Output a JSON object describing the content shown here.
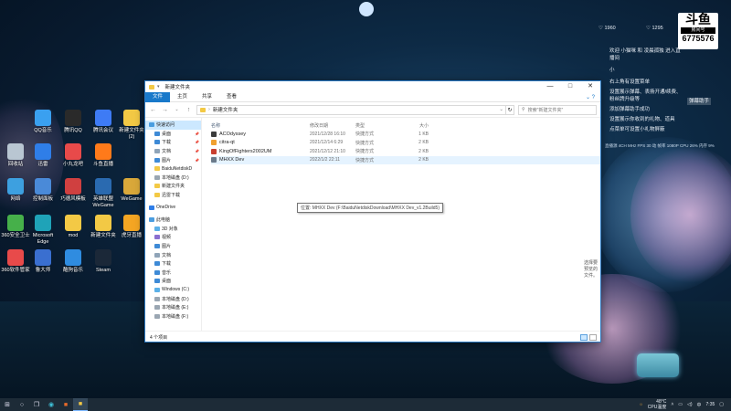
{
  "desktop": {
    "icons": [
      {
        "label": "QQ音乐",
        "color": "#3aa0f0"
      },
      {
        "label": "腾讯QQ",
        "color": "#2a2a2a"
      },
      {
        "label": "腾讯会议",
        "color": "#3e7bf5"
      },
      {
        "label": "新建文件夹 (2)",
        "color": "#f3c945"
      },
      {
        "label": "回收站",
        "color": "#b9c6d2"
      },
      {
        "label": "迅雷",
        "color": "#2f7ee8"
      },
      {
        "label": "小丸龙吧",
        "color": "#e84a4a"
      },
      {
        "label": "斗鱼直播",
        "color": "#ff7a1a"
      },
      {
        "label": "网络",
        "color": "#3da0e0"
      },
      {
        "label": "控制面板",
        "color": "#4a8ad8"
      },
      {
        "label": "巧德风模板",
        "color": "#d04040"
      },
      {
        "label": "英雄联盟WeGame",
        "color": "#2a6ab0"
      },
      {
        "label": "WeGame",
        "color": "#d9a83a"
      },
      {
        "label": "360安全卫士",
        "color": "#46b04a"
      },
      {
        "label": "Microsoft Edge",
        "color": "#1fa3b8"
      },
      {
        "label": "mod",
        "color": "#f3c945"
      },
      {
        "label": "新建文件夹",
        "color": "#f3c945"
      },
      {
        "label": "虎牙直播",
        "color": "#f5a623"
      },
      {
        "label": "360软件管家",
        "color": "#e84a4a"
      },
      {
        "label": "鲁大师",
        "color": "#3a6fd0"
      },
      {
        "label": "酷狗音乐",
        "color": "#2f8ce0"
      },
      {
        "label": "Steam",
        "color": "#1b2838"
      }
    ]
  },
  "overlay": {
    "fan_left": "1960",
    "fan_right": "1295",
    "logo_top": "斗鱼",
    "logo_sub": "房间号",
    "room_number": "6775576",
    "messages": [
      "欢迎 小猫咪 和 凌晨孤独 进入直播间",
      "小",
      "右上角有设置菜单",
      "设置展示弹幕、表扬开通/续费、粉丝牌升级等",
      "添加弹幕助手成功",
      "设置展示你收到的礼物、道具",
      "点菜单可设置小礼物屏蔽"
    ],
    "side_tag": "弹幕助手",
    "stats": "直播源  4CH  MHz  FPS 30  动 帧率  1080P  CPU 26%  内存 9%"
  },
  "explorer": {
    "title": "新建文件夹",
    "window_controls": [
      "—",
      "□",
      "✕"
    ],
    "ribbon_tabs": [
      "文件",
      "主页",
      "共享",
      "查看"
    ],
    "address": "新建文件夹",
    "search_placeholder": "搜索\"新建文件夹\"",
    "nav": [
      {
        "label": "快速访问",
        "indent": false,
        "selected": true,
        "pin": false,
        "color": "#4a9de0"
      },
      {
        "label": "桌面",
        "indent": true,
        "selected": false,
        "pin": true,
        "color": "#3e8ad6"
      },
      {
        "label": "下载",
        "indent": true,
        "selected": false,
        "pin": true,
        "color": "#3e8ad6"
      },
      {
        "label": "文档",
        "indent": true,
        "selected": false,
        "pin": true,
        "color": "#8fa4b8"
      },
      {
        "label": "图片",
        "indent": true,
        "selected": false,
        "pin": true,
        "color": "#3e8ad6"
      },
      {
        "label": "BaiduNetdiskD",
        "indent": true,
        "selected": false,
        "pin": false,
        "color": "#f3c945"
      },
      {
        "label": "本地磁盘 (D:)",
        "indent": true,
        "selected": false,
        "pin": false,
        "color": "#9aa6b2"
      },
      {
        "label": "新建文件夹",
        "indent": true,
        "selected": false,
        "pin": false,
        "color": "#f3c945"
      },
      {
        "label": "迅雷下载",
        "indent": true,
        "selected": false,
        "pin": false,
        "color": "#f3c945"
      },
      {
        "label": "",
        "indent": false,
        "selected": false,
        "pin": false,
        "color": ""
      },
      {
        "label": "OneDrive",
        "indent": false,
        "selected": false,
        "pin": false,
        "color": "#2f7ee8"
      },
      {
        "label": "",
        "indent": false,
        "selected": false,
        "pin": false,
        "color": ""
      },
      {
        "label": "此电脑",
        "indent": false,
        "selected": false,
        "pin": false,
        "color": "#4a9de0"
      },
      {
        "label": "3D 对象",
        "indent": true,
        "selected": false,
        "pin": false,
        "color": "#5ab0e8"
      },
      {
        "label": "视频",
        "indent": true,
        "selected": false,
        "pin": false,
        "color": "#8a6fd0"
      },
      {
        "label": "图片",
        "indent": true,
        "selected": false,
        "pin": false,
        "color": "#3e8ad6"
      },
      {
        "label": "文档",
        "indent": true,
        "selected": false,
        "pin": false,
        "color": "#8fa4b8"
      },
      {
        "label": "下载",
        "indent": true,
        "selected": false,
        "pin": false,
        "color": "#3e8ad6"
      },
      {
        "label": "音乐",
        "indent": true,
        "selected": false,
        "pin": false,
        "color": "#3e8ad6"
      },
      {
        "label": "桌面",
        "indent": true,
        "selected": false,
        "pin": false,
        "color": "#3e8ad6"
      },
      {
        "label": "Windows (C:)",
        "indent": true,
        "selected": false,
        "pin": false,
        "color": "#5ab0e8"
      },
      {
        "label": "本地磁盘 (D:)",
        "indent": true,
        "selected": false,
        "pin": false,
        "color": "#9aa6b2"
      },
      {
        "label": "本地磁盘 (E:)",
        "indent": true,
        "selected": false,
        "pin": false,
        "color": "#9aa6b2"
      },
      {
        "label": "本地磁盘 (F:)",
        "indent": true,
        "selected": false,
        "pin": false,
        "color": "#9aa6b2"
      }
    ],
    "columns": {
      "name": "名称",
      "date": "修改日期",
      "type": "类型",
      "size": "大小"
    },
    "files": [
      {
        "name": "ACOdyssey",
        "date": "2021/12/28 16:10",
        "type": "快捷方式",
        "size": "1 KB",
        "icon": "#3b3b3b"
      },
      {
        "name": "citra-qt",
        "date": "2021/12/14 6:29",
        "type": "快捷方式",
        "size": "2 KB",
        "icon": "#f0a030"
      },
      {
        "name": "KingOfFighters2002UM",
        "date": "2021/12/12 21:10",
        "type": "快捷方式",
        "size": "2 KB",
        "icon": "#c84030"
      },
      {
        "name": "MHXX Dev",
        "date": "2022/1/2 22:11",
        "type": "快捷方式",
        "size": "2 KB",
        "icon": "#6a7a8a"
      }
    ],
    "tooltip": "位置: MHXX Dev (F:\\BaiduNetdiskDownload\\MHXX Dev_v1.2Build5)",
    "empty_preview": "选择要预览的文件。",
    "status": "4 个项目"
  },
  "taskbar": {
    "weather_temp": "48°C",
    "weather_label": "CPU温度",
    "clock": "7:35"
  }
}
